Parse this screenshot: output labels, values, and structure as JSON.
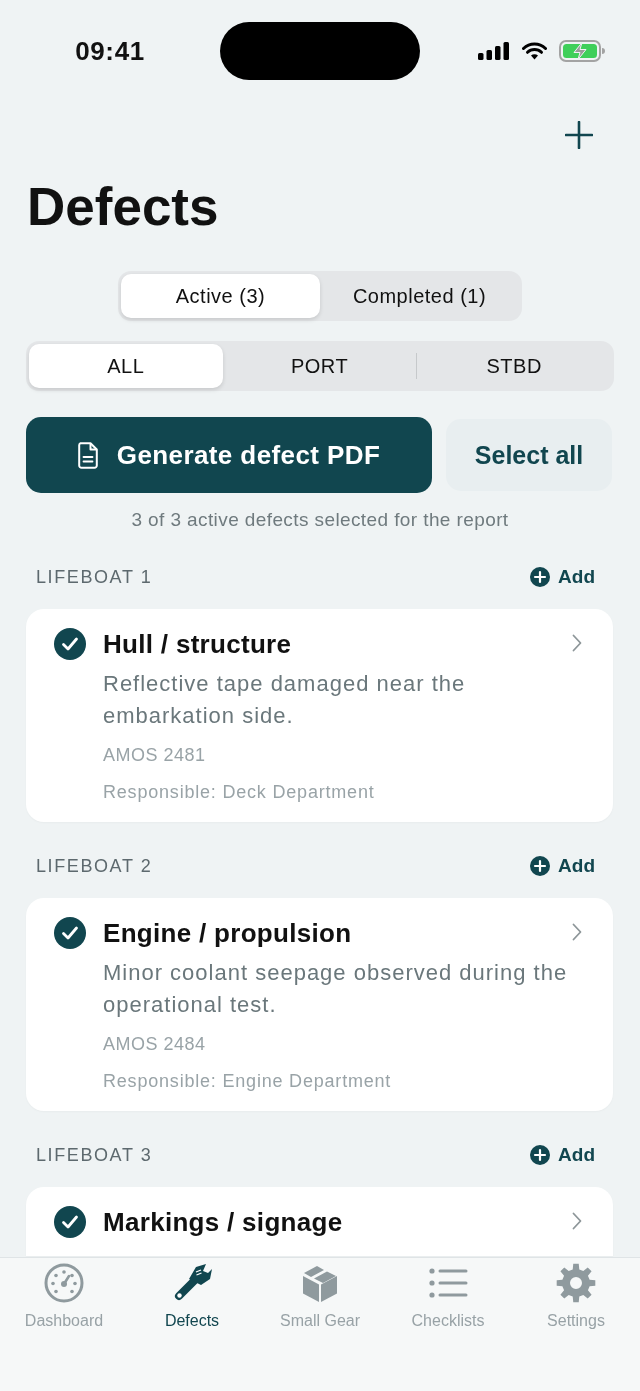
{
  "status_bar": {
    "time": "09:41"
  },
  "header": {
    "title": "Defects"
  },
  "status_tabs": [
    {
      "label": "Active (3)",
      "selected": true
    },
    {
      "label": "Completed (1)",
      "selected": false
    }
  ],
  "side_filter": [
    {
      "label": "ALL",
      "selected": true
    },
    {
      "label": "PORT",
      "selected": false
    },
    {
      "label": "STBD",
      "selected": false
    }
  ],
  "actions": {
    "generate_button": "Generate defect PDF",
    "select_all_button": "Select all",
    "summary": "3 of 3 active defects selected for the report"
  },
  "sections": [
    {
      "title": "LIFEBOAT 1",
      "add_label": "Add",
      "defects": [
        {
          "title": "Hull / structure",
          "description": "Reflective tape damaged near the embarkation side.",
          "reference": "AMOS 2481",
          "responsible": "Responsible: Deck Department",
          "checked": true
        }
      ]
    },
    {
      "title": "LIFEBOAT 2",
      "add_label": "Add",
      "defects": [
        {
          "title": "Engine / propulsion",
          "description": "Minor coolant seepage observed during the operational test.",
          "reference": "AMOS 2484",
          "responsible": "Responsible: Engine Department",
          "checked": true
        }
      ]
    },
    {
      "title": "LIFEBOAT 3",
      "add_label": "Add",
      "defects": [
        {
          "title": "Markings / signage",
          "checked": true
        }
      ]
    }
  ],
  "tab_bar": [
    {
      "label": "Dashboard",
      "kind": "gauge",
      "selected": false
    },
    {
      "label": "Defects",
      "kind": "wrench",
      "selected": true
    },
    {
      "label": "Small Gear",
      "kind": "box",
      "selected": false
    },
    {
      "label": "Checklists",
      "kind": "list",
      "selected": false
    },
    {
      "label": "Settings",
      "kind": "gear",
      "selected": false
    }
  ]
}
